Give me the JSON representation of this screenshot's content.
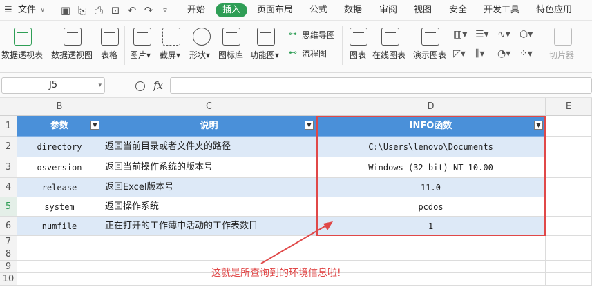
{
  "menu": {
    "file_label": "文件",
    "tabs": [
      "开始",
      "插入",
      "页面布局",
      "公式",
      "数据",
      "审阅",
      "视图",
      "安全",
      "开发工具",
      "特色应用"
    ],
    "active_tab": "插入"
  },
  "ribbon": {
    "pivot_table": "数据透视表",
    "pivot_chart": "数据透视图",
    "table": "表格",
    "picture": "图片",
    "screenshot": "截屏",
    "shape": "形状",
    "icon_lib": "图标库",
    "function_chart": "功能图",
    "mind_map": "思维导图",
    "flowchart": "流程图",
    "chart": "图表",
    "online_chart": "在线图表",
    "demo_chart": "演示图表",
    "slicer": "切片器"
  },
  "formula_bar": {
    "name_box": "J5",
    "fx": "fx",
    "formula": ""
  },
  "sheet": {
    "columns": [
      "B",
      "C",
      "D",
      "E"
    ],
    "rows": [
      "1",
      "2",
      "3",
      "4",
      "5",
      "6",
      "7",
      "8",
      "9",
      "10"
    ],
    "headers": {
      "param": "参数",
      "desc": "说明",
      "func": "INFO函数"
    },
    "data": [
      {
        "param": "directory",
        "desc": "返回当前目录或者文件夹的路径",
        "value": "C:\\Users\\lenovo\\Documents"
      },
      {
        "param": "osversion",
        "desc": "返回当前操作系统的版本号",
        "value": "Windows (32-bit) NT 10.00"
      },
      {
        "param": "release",
        "desc": "返回Excel版本号",
        "value": "11.0"
      },
      {
        "param": "system",
        "desc": "返回操作系统",
        "value": "pcdos"
      },
      {
        "param": "numfile",
        "desc": "正在打开的工作薄中活动的工作表数目",
        "value": "1"
      }
    ],
    "annotation": "这就是所查询到的环境信息啦!",
    "highlight_color": "#e04848",
    "header_color": "#4a90d9",
    "band_color": "#dde9f7",
    "selected_row": "5"
  }
}
